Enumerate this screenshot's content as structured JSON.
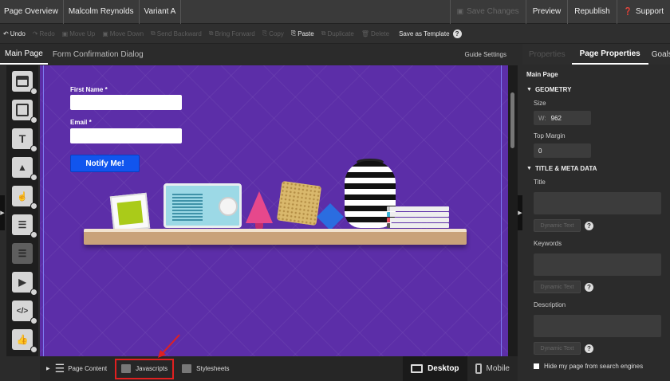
{
  "topbar": {
    "breadcrumbs": [
      "Page Overview",
      "Malcolm Reynolds",
      "Variant A"
    ],
    "save_changes": "Save Changes",
    "preview": "Preview",
    "republish": "Republish",
    "support": "Support"
  },
  "toolbar": {
    "undo": "Undo",
    "redo": "Redo",
    "move_up": "Move Up",
    "move_down": "Move Down",
    "send_backward": "Send Backward",
    "bring_forward": "Bring Forward",
    "copy": "Copy",
    "paste": "Paste",
    "duplicate": "Duplicate",
    "delete": "Delete",
    "save_as_template": "Save as Template"
  },
  "tabs": {
    "main_page": "Main Page",
    "form_confirmation": "Form Confirmation Dialog",
    "guide_settings": "Guide Settings"
  },
  "canvas": {
    "first_name_label": "First Name *",
    "email_label": "Email *",
    "notify_button": "Notify Me!"
  },
  "bottombar": {
    "page_content": "Page Content",
    "javascripts": "Javascripts",
    "stylesheets": "Stylesheets",
    "desktop": "Desktop",
    "mobile": "Mobile"
  },
  "right_panel": {
    "tabs": [
      "Properties",
      "Page Properties",
      "Goals"
    ],
    "page_name": "Main Page",
    "geometry_header": "GEOMETRY",
    "size_label": "Size",
    "width_prefix": "W:",
    "width_value": "962",
    "top_margin_label": "Top Margin",
    "top_margin_value": "0",
    "meta_header": "TITLE & META DATA",
    "title_label": "Title",
    "keywords_label": "Keywords",
    "description_label": "Description",
    "dynamic_text": "Dynamic Text",
    "hide_checkbox_label": "Hide my page from search engines"
  },
  "colors": {
    "canvas_bg": "#5c2ea8",
    "notify_button": "#1155ee",
    "highlight": "#e02020"
  }
}
